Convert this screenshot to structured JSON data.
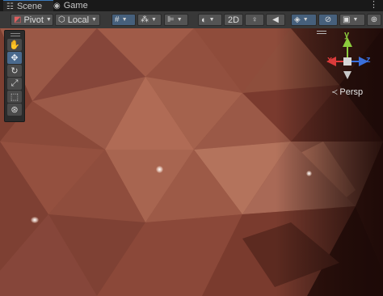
{
  "tabs": [
    {
      "label": "Scene",
      "icon": "grid-icon"
    },
    {
      "label": "Game",
      "icon": "gamepad-icon"
    }
  ],
  "toolbar": {
    "pivot_label": "Pivot",
    "local_label": "Local",
    "mode_2d_label": "2D"
  },
  "gizmo": {
    "y_label": "y",
    "x_label": "x",
    "z_label": "z",
    "projection_label": "Persp"
  },
  "colors": {
    "accent": "#3a79bb",
    "gizmo_x": "#db3b3b",
    "gizmo_y": "#8ccc3d",
    "gizmo_z": "#3a6fdb",
    "terrain_base": "#8a4b3a"
  }
}
